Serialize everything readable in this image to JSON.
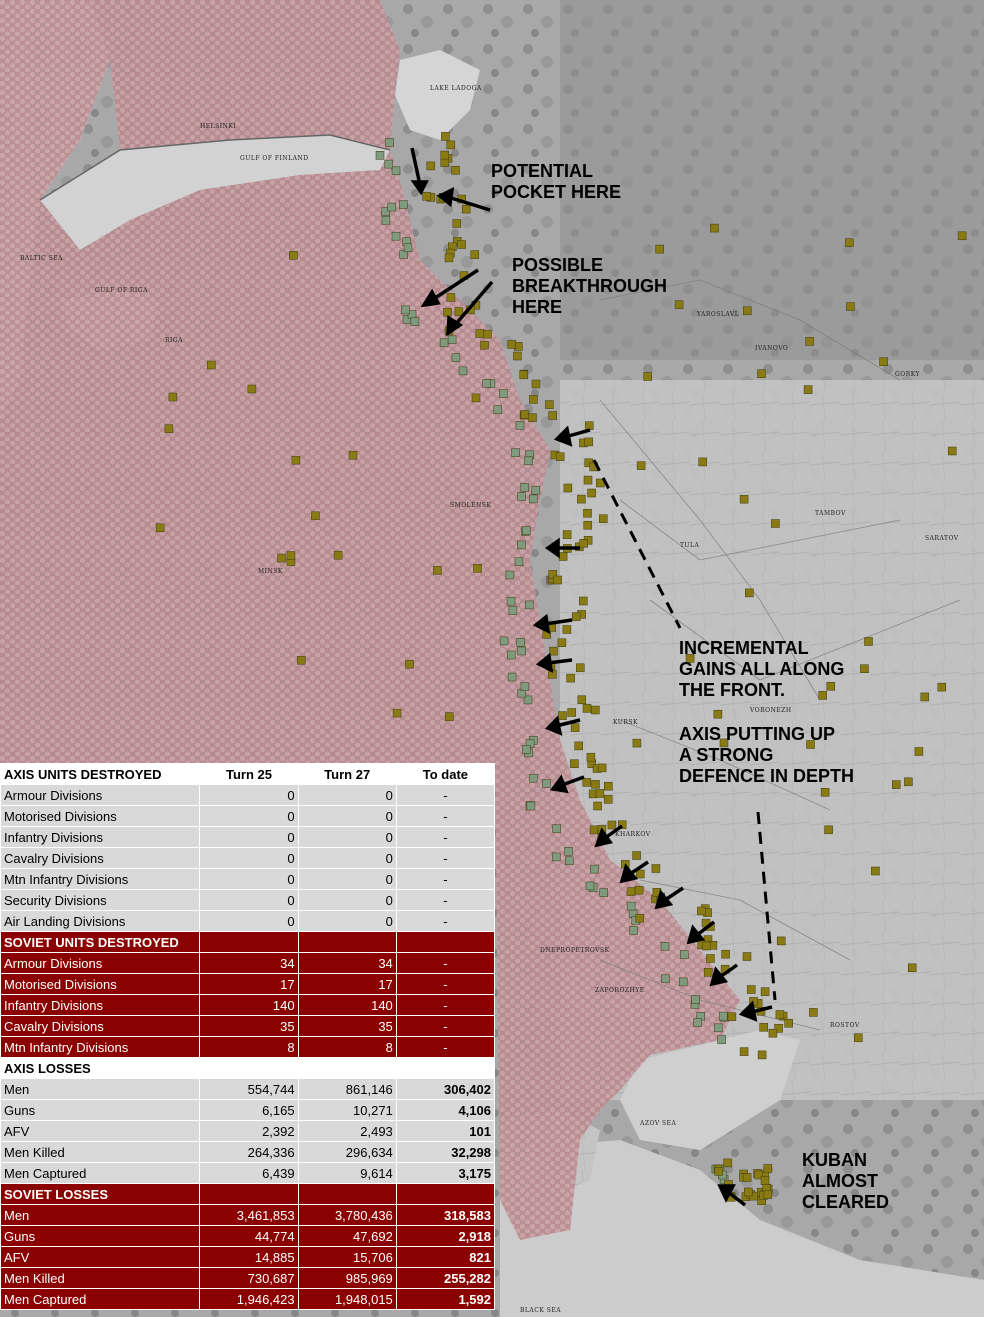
{
  "map": {
    "places": [
      "Lake Ladoga",
      "Gulf of Finland",
      "Gulf of Riga",
      "Baltic Sea",
      "Helsinki",
      "Riga",
      "Minsk",
      "Smolensk",
      "Yaroslavl",
      "Ivanovo",
      "Gorky",
      "Tula",
      "Tambov",
      "Kursk",
      "Voronezh",
      "Kharkov",
      "Dnepropetrovsk",
      "Zaporozhye",
      "Rostov",
      "Saratov",
      "Azov Sea",
      "Black Sea"
    ],
    "colors": {
      "axis_control": "#b98a8f",
      "soviet_unit": "#8a7a14",
      "axis_unit": "#7f9a7e",
      "sea": "#cfcfcf"
    }
  },
  "annotations": {
    "pocket": [
      "POTENTIAL",
      "POCKET HERE"
    ],
    "breakthrough": [
      "POSSIBLE",
      "BREAKTHROUGH",
      "HERE"
    ],
    "gains": [
      "INCREMENTAL",
      "GAINS ALL ALONG",
      "THE FRONT."
    ],
    "defence": [
      "AXIS PUTTING UP",
      "A STRONG",
      "DEFENCE IN DEPTH"
    ],
    "kuban": [
      "KUBAN",
      "ALMOST",
      "CLEARED"
    ]
  },
  "table": {
    "columns": [
      "Turn 25",
      "Turn 27",
      "To date"
    ],
    "axis_units": {
      "title": "AXIS UNITS DESTROYED",
      "rows": [
        {
          "label": "Armour Divisions",
          "t25": "0",
          "t27": "0",
          "todate": "-"
        },
        {
          "label": "Motorised Divisions",
          "t25": "0",
          "t27": "0",
          "todate": "-"
        },
        {
          "label": "Infantry Divisions",
          "t25": "0",
          "t27": "0",
          "todate": "-"
        },
        {
          "label": "Cavalry Divisions",
          "t25": "0",
          "t27": "0",
          "todate": "-"
        },
        {
          "label": "Mtn Infantry Divisions",
          "t25": "0",
          "t27": "0",
          "todate": "-"
        },
        {
          "label": "Security Divisions",
          "t25": "0",
          "t27": "0",
          "todate": "-"
        },
        {
          "label": "Air Landing Divisions",
          "t25": "0",
          "t27": "0",
          "todate": "-"
        }
      ]
    },
    "soviet_units": {
      "title": "SOVIET UNITS DESTROYED",
      "rows": [
        {
          "label": "Armour Divisions",
          "t25": "34",
          "t27": "34",
          "todate": "-"
        },
        {
          "label": "Motorised Divisions",
          "t25": "17",
          "t27": "17",
          "todate": "-"
        },
        {
          "label": "Infantry Divisions",
          "t25": "140",
          "t27": "140",
          "todate": "-"
        },
        {
          "label": "Cavalry Divisions",
          "t25": "35",
          "t27": "35",
          "todate": "-"
        },
        {
          "label": "Mtn Infantry Divisions",
          "t25": "8",
          "t27": "8",
          "todate": "-"
        }
      ]
    },
    "axis_losses": {
      "title": "AXIS LOSSES",
      "rows": [
        {
          "label": "Men",
          "t25": "554,744",
          "t27": "861,146",
          "todate": "306,402"
        },
        {
          "label": "Guns",
          "t25": "6,165",
          "t27": "10,271",
          "todate": "4,106"
        },
        {
          "label": "AFV",
          "t25": "2,392",
          "t27": "2,493",
          "todate": "101"
        },
        {
          "label": "Men Killed",
          "t25": "264,336",
          "t27": "296,634",
          "todate": "32,298"
        },
        {
          "label": "Men Captured",
          "t25": "6,439",
          "t27": "9,614",
          "todate": "3,175"
        }
      ]
    },
    "soviet_losses": {
      "title": "SOVIET LOSSES",
      "rows": [
        {
          "label": "Men",
          "t25": "3,461,853",
          "t27": "3,780,436",
          "todate": "318,583"
        },
        {
          "label": "Guns",
          "t25": "44,774",
          "t27": "47,692",
          "todate": "2,918"
        },
        {
          "label": "AFV",
          "t25": "14,885",
          "t27": "15,706",
          "todate": "821"
        },
        {
          "label": "Men Killed",
          "t25": "730,687",
          "t27": "985,969",
          "todate": "255,282"
        },
        {
          "label": "Men Captured",
          "t25": "1,946,423",
          "t27": "1,948,015",
          "todate": "1,592"
        }
      ]
    }
  }
}
